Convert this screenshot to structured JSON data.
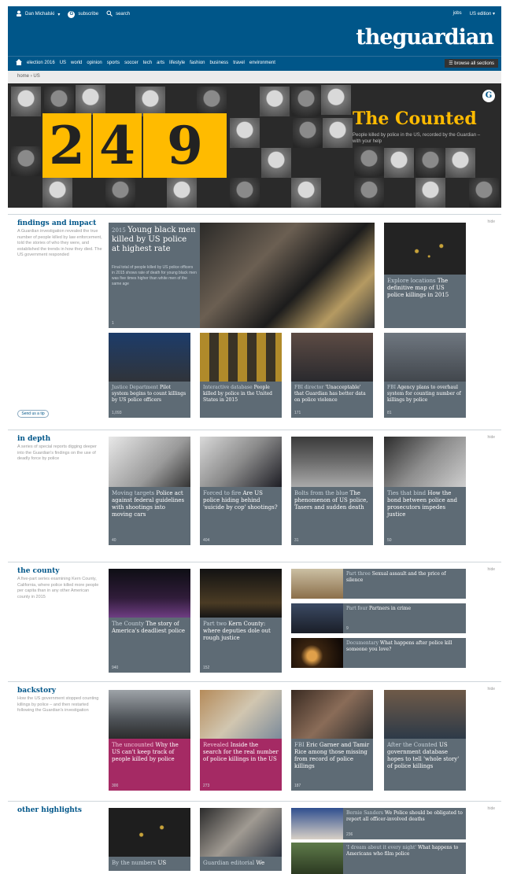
{
  "topbar": {
    "user": "Dan Michalski",
    "subscribe": "subscribe",
    "search": "search",
    "jobs": "jobs",
    "edition": "US edition"
  },
  "logo": "theguardian",
  "nav": {
    "items": [
      "election 2016",
      "US",
      "world",
      "opinion",
      "sports",
      "soccer",
      "tech",
      "arts",
      "lifestyle",
      "fashion",
      "business",
      "travel",
      "environment"
    ],
    "browse": "browse all sections"
  },
  "breadcrumb": [
    "home",
    "US"
  ],
  "hero": {
    "digits": [
      "2",
      "4",
      "9"
    ],
    "title": "The Counted",
    "subtitle": "People killed by police in the US, recorded by the Guardian – with your help"
  },
  "colors": {
    "brand": "#005689",
    "accent": "#ffbb00",
    "card": "#5e6b75",
    "pink": "#a52a64"
  },
  "sections": [
    {
      "title": "findings and impact",
      "desc": "A Guardian investigation revealed the true number of people killed by law enforcement, told the stories of who they were, and established the trends in how they died. The US government responded",
      "hide": "hide",
      "tip": "Send us a tip",
      "cards": [
        {
          "kicker": "2015",
          "headline": "Young black men killed by US police at highest rate",
          "standfirst": "Final total of people killed by US police officers in 2015 shows rate of death for young black men was five times higher than white men of the same age",
          "count": "1"
        },
        {
          "kicker": "Explore locations",
          "headline": "The definitive map of US police killings in 2015",
          "count": ""
        },
        {
          "kicker": "Justice Department",
          "headline": "Pilot system begins to count killings by US police officers",
          "count": "1,093"
        },
        {
          "kicker": "Interactive database",
          "headline": "People killed by police in the United States in 2015",
          "count": ""
        },
        {
          "kicker": "FBI director",
          "headline": "'Unacceptable' that Guardian has better data on police violence",
          "count": "171"
        },
        {
          "kicker": "FBI",
          "headline": "Agency plans to overhaul system for counting number of killings by police",
          "count": "81"
        }
      ]
    },
    {
      "title": "in depth",
      "desc": "A series of special reports digging deeper into the Guardian's findings on the use of deadly force by police",
      "hide": "hide",
      "cards": [
        {
          "kicker": "Moving targets",
          "headline": "Police act against federal guidelines with shootings into moving cars",
          "count": "40"
        },
        {
          "kicker": "Forced to fire",
          "headline": "Are US police hiding behind 'suicide by cop' shootings?",
          "count": "404"
        },
        {
          "kicker": "Bolts from the blue",
          "headline": "The phenomenon of US police, Tasers and sudden death",
          "count": "31"
        },
        {
          "kicker": "Ties that bind",
          "headline": "How the bond between police and prosecutors impedes justice",
          "count": "50"
        }
      ]
    },
    {
      "title": "the county",
      "desc": "A five-part series examining Kern County, California, where police killed more people per capita than in any other American county in 2015",
      "hide": "hide",
      "cards": [
        {
          "kicker": "The County",
          "headline": "The story of America's deadliest police",
          "count": "940"
        },
        {
          "kicker": "Part two",
          "headline": "Kern County: where deputies dole out rough justice",
          "count": "152"
        }
      ],
      "rows": [
        {
          "kicker": "Part three",
          "headline": "Sexual assault and the price of silence",
          "count": ""
        },
        {
          "kicker": "Part four",
          "headline": "Partners in crime",
          "count": "9"
        },
        {
          "kicker": "Documentary",
          "headline": "What happens after police kill someone you love?",
          "count": ""
        }
      ]
    },
    {
      "title": "backstory",
      "desc": "How the US government stopped counting killings by police – and then restarted following the Guardian's investigation",
      "hide": "hide",
      "cards": [
        {
          "kicker": "The uncounted",
          "headline": "Why the US can't keep track of people killed by police",
          "count": "300"
        },
        {
          "kicker": "Revealed",
          "headline": "Inside the search for the real number of police killings in the US",
          "count": "273"
        },
        {
          "kicker": "FBI",
          "headline": "Eric Garner and Tamir Rice among those missing from record of police killings",
          "count": "187"
        },
        {
          "kicker": "After the Counted",
          "headline": "US government database hopes to tell 'whole story' of police killings",
          "count": ""
        }
      ]
    },
    {
      "title": "other highlights",
      "desc": "",
      "hide": "hide",
      "cards": [
        {
          "kicker": "By the numbers",
          "headline": "US",
          "count": ""
        },
        {
          "kicker": "Guardian editorial",
          "headline": "We",
          "count": ""
        }
      ],
      "rows": [
        {
          "kicker": "Bernie Sanders",
          "headline": "We Police should be obligated to report all officer-involved deaths",
          "count": "236"
        },
        {
          "kicker": "'I dream about it every night'",
          "headline": "What happens to Americans who film police",
          "count": ""
        }
      ]
    }
  ]
}
